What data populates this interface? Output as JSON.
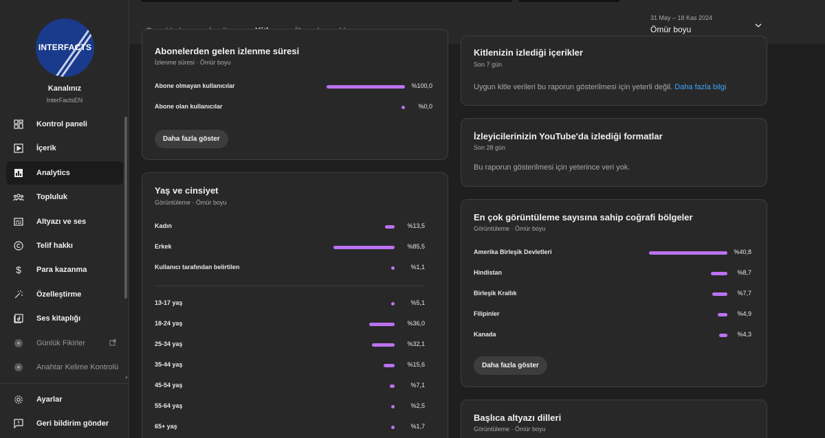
{
  "channel": {
    "logo_text": "INTERFACTS",
    "name": "Kanalınız",
    "handle": "InterFactsEN"
  },
  "sidebar": {
    "items": [
      {
        "label": "Kontrol paneli",
        "icon": "dashboard-icon"
      },
      {
        "label": "İçerik",
        "icon": "content-icon"
      },
      {
        "label": "Analytics",
        "icon": "analytics-icon"
      },
      {
        "label": "Topluluk",
        "icon": "community-icon"
      },
      {
        "label": "Altyazı ve ses",
        "icon": "subtitles-icon"
      },
      {
        "label": "Telif hakkı",
        "icon": "copyright-icon"
      },
      {
        "label": "Para kazanma",
        "icon": "dollar-icon"
      },
      {
        "label": "Özelleştirme",
        "icon": "magic-wand-icon"
      },
      {
        "label": "Ses kitaplığı",
        "icon": "audio-library-icon"
      },
      {
        "label": "Günlük Fikirler",
        "icon": "extension-icon"
      },
      {
        "label": "Anahtar Kelime Kontrolü",
        "icon": "extension-icon"
      }
    ],
    "bottom": [
      {
        "label": "Ayarlar",
        "icon": "settings-gear-icon"
      },
      {
        "label": "Geri bildirim gönder",
        "icon": "feedback-icon"
      }
    ]
  },
  "tabs": [
    "Genel bakış",
    "İçerik",
    "Kitle",
    "İlham kaynakları"
  ],
  "date": {
    "range": "31 May – 18 Kas 2024",
    "label": "Ömür boyu"
  },
  "accent_color": "#bb72f0",
  "cards": {
    "watch_time": {
      "title": "Abonelerden gelen izlenme süresi",
      "subtitle": "İzlenme süresi · Ömür boyu",
      "rows": [
        {
          "label": "Abone olmayan kullanıcılar",
          "value": "%100,0",
          "pct": 100.0
        },
        {
          "label": "Abone olan kullanıcılar",
          "value": "%0,0",
          "pct": 0.0
        }
      ],
      "button": "Daha fazla göster"
    },
    "age_gender": {
      "title": "Yaş ve cinsiyet",
      "subtitle": "Görüntüleme · Ömür boyu",
      "gender": [
        {
          "label": "Kadın",
          "value": "%13,5",
          "pct": 13.5
        },
        {
          "label": "Erkek",
          "value": "%85,5",
          "pct": 85.5
        },
        {
          "label": "Kullanıcı tarafından belirtilen",
          "value": "%1,1",
          "pct": 1.1
        }
      ],
      "ages": [
        {
          "label": "13-17 yaş",
          "value": "%5,1",
          "pct": 5.1
        },
        {
          "label": "18-24 yaş",
          "value": "%36,0",
          "pct": 36.0
        },
        {
          "label": "25-34 yaş",
          "value": "%32,1",
          "pct": 32.1
        },
        {
          "label": "35-44 yaş",
          "value": "%15,6",
          "pct": 15.6
        },
        {
          "label": "45-54 yaş",
          "value": "%7,1",
          "pct": 7.1
        },
        {
          "label": "55-64 yaş",
          "value": "%2,5",
          "pct": 2.5
        },
        {
          "label": "65+ yaş",
          "value": "%1,7",
          "pct": 1.7
        }
      ]
    },
    "audience_watches": {
      "title": "Kitlenizin izlediği içerikler",
      "subtitle": "Son 7 gün",
      "message": "Uygun kitle verileri bu raporun gösterilmesi için yeterli değil.",
      "link": "Daha fazla bilgi"
    },
    "formats": {
      "title": "İzleyicilerinizin YouTube'da izlediği formatlar",
      "subtitle": "Son 28 gün",
      "message": "Bu raporun gösterilmesi için yeterince veri yok."
    },
    "geography": {
      "title": "En çok görüntüleme sayısına sahip coğrafi bölgeler",
      "subtitle": "Görüntüleme · Ömür boyu",
      "rows": [
        {
          "label": "Amerika Birleşik Devletleri",
          "value": "%40,8",
          "pct": 40.8
        },
        {
          "label": "Hindistan",
          "value": "%8,7",
          "pct": 8.7
        },
        {
          "label": "Birleşik Krallık",
          "value": "%7,7",
          "pct": 7.7
        },
        {
          "label": "Filipinler",
          "value": "%4,9",
          "pct": 4.9
        },
        {
          "label": "Kanada",
          "value": "%4,3",
          "pct": 4.3
        }
      ],
      "button": "Daha fazla göster"
    },
    "subtitles": {
      "title": "Başlıca altyazı dilleri",
      "subtitle": "Görüntüleme · Ömür boyu"
    }
  }
}
